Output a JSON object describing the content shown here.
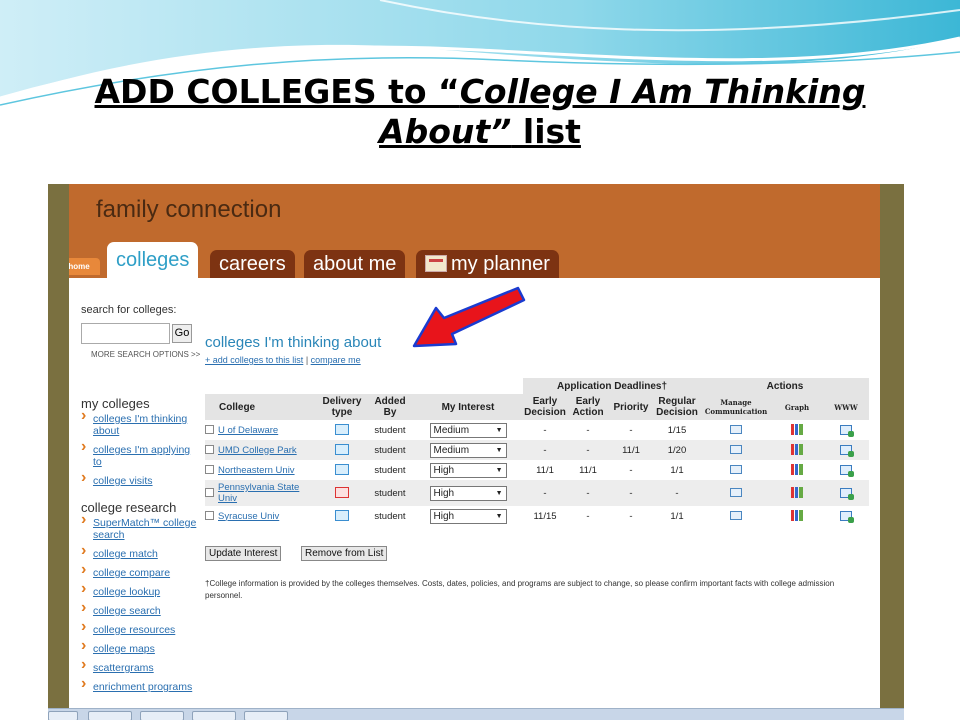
{
  "slide": {
    "title_part1": "ADD COLLEGES to “",
    "title_italic": "College I Am Thinking About”",
    "title_part3": " list"
  },
  "app": {
    "brand": "family connection",
    "tabs": {
      "home": "home",
      "colleges": "colleges",
      "careers": "careers",
      "about_me": "about me",
      "my_planner": "my planner"
    }
  },
  "sidebar": {
    "search_label": "search for colleges:",
    "go_label": "Go",
    "more_options": "MORE SEARCH OPTIONS >>",
    "my_colleges_heading": "my colleges",
    "my_colleges": [
      "colleges I'm thinking about",
      "colleges I'm applying to",
      "college visits"
    ],
    "research_heading": "college research",
    "research": [
      "SuperMatch™ college search",
      "college match",
      "college compare",
      "college lookup",
      "college search",
      "college resources",
      "college maps",
      "scattergrams",
      "enrichment programs"
    ]
  },
  "main": {
    "title": "colleges I'm thinking about",
    "add_link": "+ add colleges to this list",
    "separator": " | ",
    "compare_link": "compare me",
    "headers": {
      "college": "College",
      "delivery": "Delivery type",
      "added_by": "Added By",
      "interest": "My Interest",
      "deadlines": "Application Deadlines†",
      "early_decision": "Early Decision",
      "early_action": "Early Action",
      "priority": "Priority",
      "regular": "Regular Decision",
      "actions": "Actions",
      "manage": "Manage Communication",
      "graph": "Graph",
      "www": "WWW"
    },
    "rows": [
      {
        "college": "U of Delaware",
        "added_by": "student",
        "interest": "Medium",
        "ed": "-",
        "ea": "-",
        "priority": "-",
        "regular": "1/15"
      },
      {
        "college": "UMD College Park",
        "added_by": "student",
        "interest": "Medium",
        "ed": "-",
        "ea": "-",
        "priority": "11/1",
        "regular": "1/20"
      },
      {
        "college": "Northeastern Univ",
        "added_by": "student",
        "interest": "High",
        "ed": "11/1",
        "ea": "11/1",
        "priority": "-",
        "regular": "1/1"
      },
      {
        "college": "Pennsylvania State Univ",
        "added_by": "student",
        "interest": "High",
        "ed": "-",
        "ea": "-",
        "priority": "-",
        "regular": "-"
      },
      {
        "college": "Syracuse Univ",
        "added_by": "student",
        "interest": "High",
        "ed": "11/15",
        "ea": "-",
        "priority": "-",
        "regular": "1/1"
      }
    ],
    "update_button": "Update Interest",
    "remove_button": "Remove from List",
    "footnote": "†College information is provided by the colleges themselves. Costs, dates, policies, and programs are subject to change, so please confirm important facts with college admission personnel."
  },
  "colors": {
    "header_orange": "#c06a2d",
    "tab_brown": "#7d3312",
    "link_blue": "#2a6fb0",
    "arrow_red": "#e8141b",
    "arrow_outline": "#1a3bd0"
  }
}
